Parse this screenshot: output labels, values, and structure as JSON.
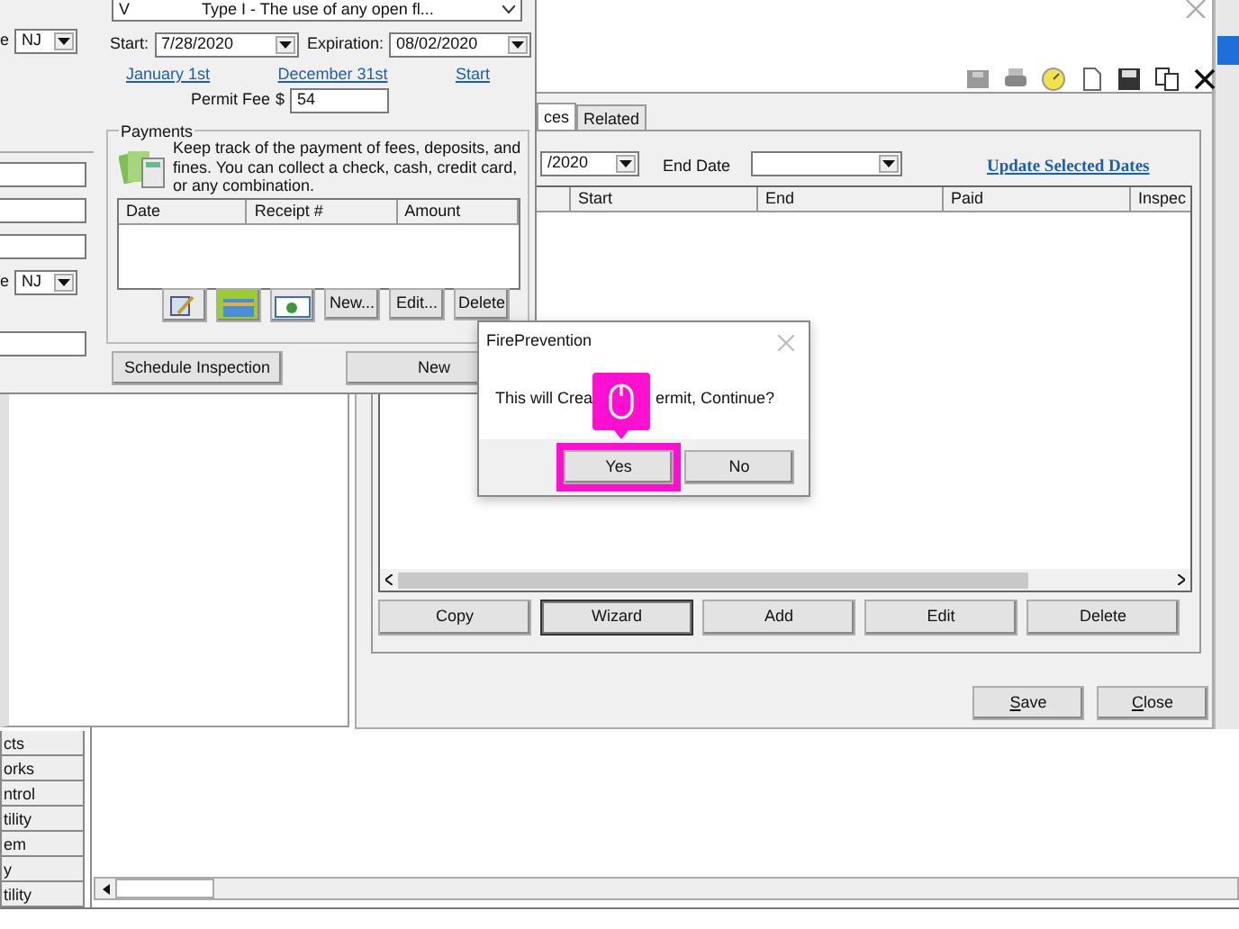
{
  "background_app": {
    "nav_items": [
      "cts",
      "orks",
      "ntrol",
      "tility",
      "em",
      "y",
      "tility"
    ]
  },
  "permit_window": {
    "tabs": [
      {
        "label": "ces",
        "selected": true
      },
      {
        "label": "Related",
        "selected": false
      }
    ],
    "start_date_value": "/2020",
    "end_date_label": "End Date",
    "update_link": "Update Selected Dates",
    "grid_columns": [
      "Start",
      "End",
      "Paid",
      "Inspec"
    ],
    "actions": [
      {
        "label": "Copy",
        "focused": false
      },
      {
        "label": "Wizard",
        "focused": true
      },
      {
        "label": "Add",
        "focused": false
      },
      {
        "label": "Edit",
        "focused": false
      },
      {
        "label": "Delete",
        "focused": false
      }
    ],
    "footer_buttons": [
      {
        "label": "Save",
        "underline_first": true
      },
      {
        "label": "Close",
        "underline_first": true
      }
    ]
  },
  "form_window": {
    "type_combo": {
      "code": "V",
      "text": "Type I - The use of any open fl..."
    },
    "state_fields": [
      {
        "label": "e",
        "value": "NJ"
      },
      {
        "label": "e",
        "value": "NJ"
      }
    ],
    "start_label": "Start:",
    "start_value": "7/28/2020",
    "expiration_label": "Expiration:",
    "expiration_value": "08/02/2020",
    "links": [
      "January 1st",
      "December 31st",
      "Start"
    ],
    "permit_fee_label": "Permit Fee",
    "currency": "$",
    "permit_fee": "54",
    "payments": {
      "title": "Payments",
      "description": "Keep track of the payment of fees, deposits, and fines. You can collect a check, cash, credit card, or any combination.",
      "columns": [
        "Date",
        "Receipt #",
        "Amount"
      ],
      "buttons": [
        "New...",
        "Edit...",
        "Delete"
      ]
    },
    "buttons": [
      "Schedule Inspection",
      "New"
    ]
  },
  "dialog": {
    "title": "FirePrevention",
    "message_parts": [
      "This will Crea",
      "ermit, Continue?"
    ],
    "buttons": [
      {
        "label": "Yes",
        "highlighted": true
      },
      {
        "label": "No",
        "highlighted": false
      }
    ]
  }
}
